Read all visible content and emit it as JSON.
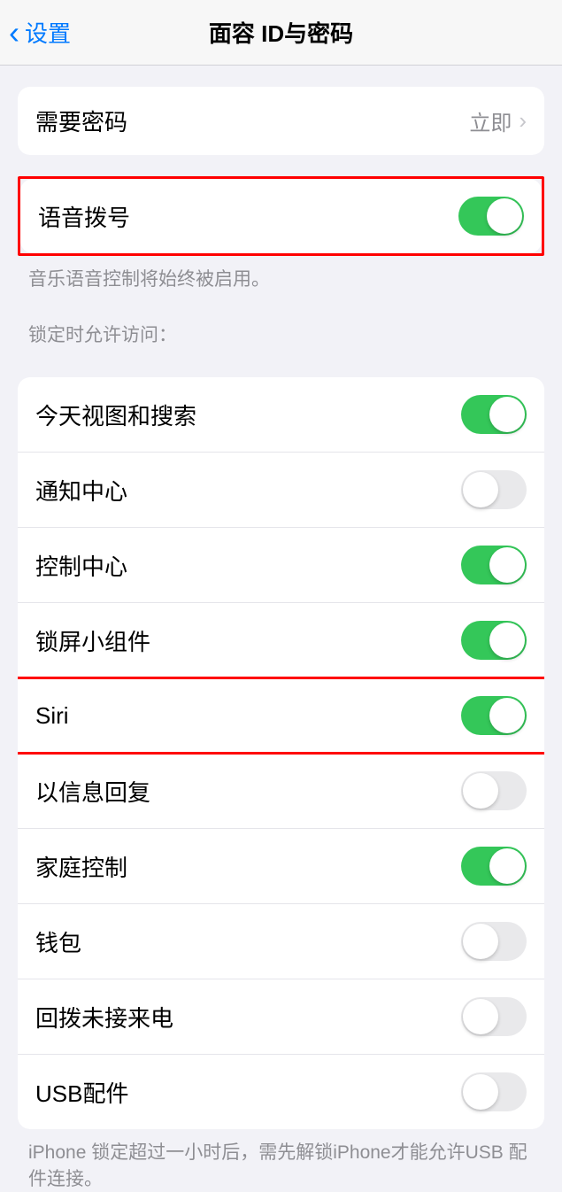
{
  "nav": {
    "back_label": "设置",
    "title": "面容 ID与密码"
  },
  "require_passcode": {
    "label": "需要密码",
    "value": "立即"
  },
  "voice_dial": {
    "label": "语音拨号",
    "on": true,
    "footer": "音乐语音控制将始终被启用。"
  },
  "lock_section": {
    "header": "锁定时允许访问：",
    "items": [
      {
        "label": "今天视图和搜索",
        "on": true
      },
      {
        "label": "通知中心",
        "on": false
      },
      {
        "label": "控制中心",
        "on": true
      },
      {
        "label": "锁屏小组件",
        "on": true
      },
      {
        "label": "Siri",
        "on": true
      },
      {
        "label": "以信息回复",
        "on": false
      },
      {
        "label": "家庭控制",
        "on": true
      },
      {
        "label": "钱包",
        "on": false
      },
      {
        "label": "回拨未接来电",
        "on": false
      },
      {
        "label": "USB配件",
        "on": false
      }
    ],
    "footer": "iPhone 锁定超过一小时后，需先解锁iPhone才能允许USB 配件连接。"
  },
  "highlighted_indices": [
    4
  ]
}
